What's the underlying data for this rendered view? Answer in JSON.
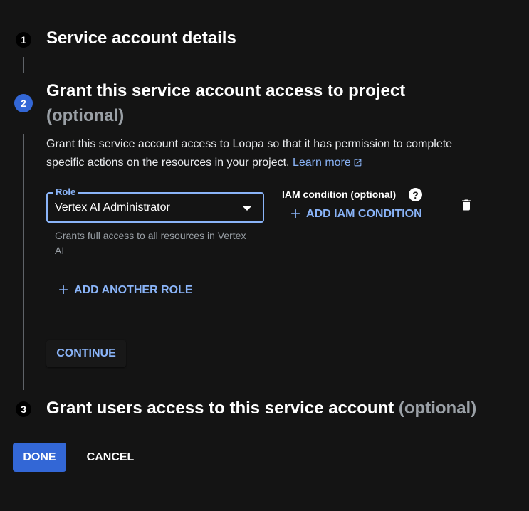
{
  "steps": [
    {
      "number": "1",
      "title": "Service account details"
    },
    {
      "number": "2",
      "title": "Grant this service account access to project",
      "optional": "(optional)"
    },
    {
      "number": "3",
      "title": "Grant users access to this service account",
      "optional": "(optional)"
    }
  ],
  "step2": {
    "description": "Grant this service account access to Loopa so that it has permission to complete specific actions on the resources in your project.",
    "learn_more": "Learn more",
    "role": {
      "label": "Role",
      "value": "Vertex AI Administrator",
      "helper": "Grants full access to all resources in Vertex AI"
    },
    "iam": {
      "label": "IAM condition (optional)",
      "help_icon": "?",
      "add_button": "ADD IAM CONDITION"
    },
    "add_role_button": "ADD ANOTHER ROLE",
    "continue_button": "CONTINUE"
  },
  "footer": {
    "done_button": "DONE",
    "cancel_button": "CANCEL"
  },
  "icons": {
    "plus": "plus-icon",
    "delete": "trash-icon",
    "external": "external-link-icon",
    "dropdown": "dropdown-arrow-icon",
    "help": "help-icon"
  },
  "colors": {
    "background": "#141414",
    "accent": "#8ab4f8",
    "primary_button": "#3367d6",
    "muted": "#9aa0a6"
  }
}
